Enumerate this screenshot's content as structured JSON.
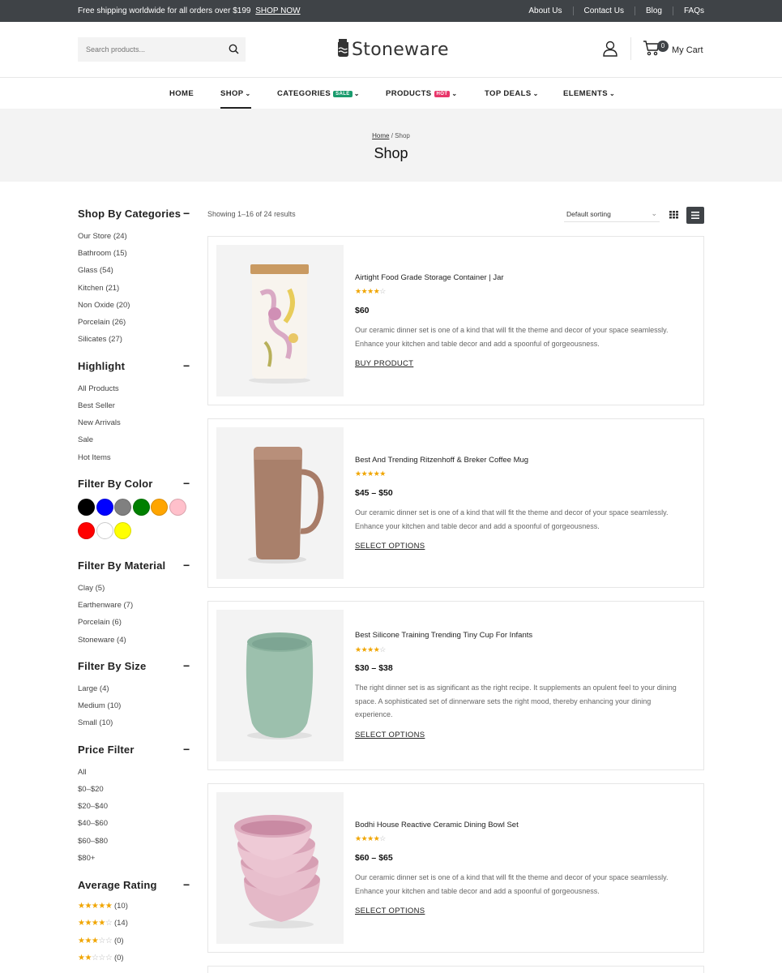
{
  "topbar": {
    "promo_text": "Free shipping worldwide for all orders over $199",
    "promo_link": "SHOP NOW",
    "links": [
      "About Us",
      "Contact Us",
      "Blog",
      "FAQs"
    ]
  },
  "header": {
    "search_placeholder": "Search products...",
    "logo_text": "Stoneware",
    "cart_count": "0",
    "cart_label": "My Cart"
  },
  "nav": {
    "items": [
      {
        "label": "HOME"
      },
      {
        "label": "SHOP",
        "chevron": "⌄"
      },
      {
        "label": "CATEGORIES",
        "chevron": "⌄",
        "tag": "SALE",
        "tag_color": "#1a9c6e"
      },
      {
        "label": "PRODUCTS",
        "chevron": "⌄",
        "tag": "HOT",
        "tag_color": "#e8366a"
      },
      {
        "label": "TOP DEALS",
        "chevron": "⌄"
      },
      {
        "label": "ELEMENTS",
        "chevron": "⌄"
      }
    ]
  },
  "banner": {
    "breadcrumb_home": "Home",
    "breadcrumb_sep": "/",
    "breadcrumb_current": "Shop",
    "title": "Shop"
  },
  "sidebar": {
    "toggle_symbol": "−",
    "categories": {
      "title": "Shop By Categories",
      "items": [
        "Our Store (24)",
        "Bathroom (15)",
        "Glass (54)",
        "Kitchen (21)",
        "Non Oxide (20)",
        "Porcelain (26)",
        "Silicates (27)"
      ]
    },
    "highlight": {
      "title": "Highlight",
      "items": [
        "All Products",
        "Best Seller",
        "New Arrivals",
        "Sale",
        "Hot Items"
      ]
    },
    "color": {
      "title": "Filter By Color",
      "swatches": [
        "#000000",
        "#0000ff",
        "#808080",
        "#008000",
        "#ffa500",
        "#ffc0cb",
        "#ff0000",
        "#ffffff",
        "#ffff00"
      ]
    },
    "material": {
      "title": "Filter By Material",
      "items": [
        "Clay (5)",
        "Earthenware (7)",
        "Porcelain (6)",
        "Stoneware (4)"
      ]
    },
    "size": {
      "title": "Filter By Size",
      "items": [
        "Large (4)",
        "Medium (10)",
        "Small (10)"
      ]
    },
    "price": {
      "title": "Price Filter",
      "items": [
        "All",
        "$0–$20",
        "$20–$40",
        "$40–$60",
        "$60–$80",
        "$80+"
      ]
    },
    "rating": {
      "title": "Average Rating",
      "items": [
        {
          "stars": 5,
          "count": "(10)"
        },
        {
          "stars": 4,
          "count": "(14)"
        },
        {
          "stars": 3,
          "count": "(0)"
        },
        {
          "stars": 2,
          "count": "(0)"
        }
      ]
    }
  },
  "toolbar": {
    "results_text": "Showing 1–16 of 24 results",
    "sort_value": "Default sorting",
    "active_view": "list"
  },
  "products": [
    {
      "name": "Airtight Food Grade Storage Container | Jar",
      "rating": 4,
      "price": "$60",
      "desc": "Our ceramic dinner set is one of a kind that will fit the theme and decor of your space seamlessly. Enhance your kitchen and table decor and add a spoonful of gorgeousness.",
      "button": "BUY PRODUCT"
    },
    {
      "name": "Best And Trending Ritzenhoff & Breker Coffee Mug",
      "rating": 5,
      "price": "$45 – $50",
      "desc": "Our ceramic dinner set is one of a kind that will fit the theme and decor of your space seamlessly. Enhance your kitchen and table decor and add a spoonful of gorgeousness.",
      "button": "SELECT OPTIONS"
    },
    {
      "name": "Best Silicone Training Trending Tiny Cup For Infants",
      "rating": 4,
      "price": "$30 – $38",
      "desc": "The right dinner set is as significant as the right recipe. It supplements an opulent feel to your dining space. A sophisticated set of dinnerware sets the right mood, thereby enhancing your dining experience.",
      "button": "SELECT OPTIONS"
    },
    {
      "name": "Bodhi House Reactive Ceramic Dining Bowl Set",
      "rating": 4,
      "price": "$60 – $65",
      "desc": "Our ceramic dinner set is one of a kind that will fit the theme and decor of your space seamlessly. Enhance your kitchen and table decor and add a spoonful of gorgeousness.",
      "button": "SELECT OPTIONS"
    }
  ]
}
